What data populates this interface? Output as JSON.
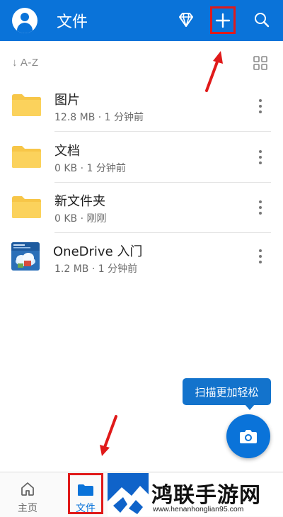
{
  "header": {
    "title": "文件"
  },
  "sort": {
    "label": "↓ A-Z"
  },
  "files": [
    {
      "name": "图片",
      "meta": "12.8 MB · 1 分钟前",
      "type": "folder"
    },
    {
      "name": "文档",
      "meta": "0 KB · 1 分钟前",
      "type": "folder"
    },
    {
      "name": "新文件夹",
      "meta": "0 KB · 刚刚",
      "type": "folder"
    },
    {
      "name": "OneDrive 入门",
      "meta": "1.2 MB · 1 分钟前",
      "type": "document"
    }
  ],
  "tooltip": {
    "text": "扫描更加轻松"
  },
  "bottom_nav": {
    "items": [
      {
        "label": "主页",
        "icon": "home-icon"
      },
      {
        "label": "文件",
        "icon": "folder-icon",
        "selected": true
      }
    ]
  },
  "watermark": {
    "title": "鸿联手游网",
    "url": "www.henanhonglian95.com"
  },
  "colors": {
    "brand_blue": "#0a73d9",
    "folder_yellow": "#f7c648",
    "highlight_red": "#e01a1a"
  }
}
